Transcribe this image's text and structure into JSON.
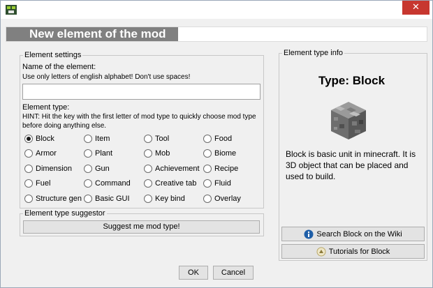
{
  "window": {
    "title": "",
    "close_glyph": "✕",
    "icon": "mcreator-app-icon"
  },
  "heading": "New element of the mod",
  "element_settings": {
    "legend": "Element settings",
    "name_label": "Name of the element:",
    "name_hint": "Use only letters of english alphabet! Don't use spaces!",
    "name_value": "",
    "type_label": "Element type:",
    "type_hint_line1": "HINT: Hit the key with the first letter of mod type to quickly choose mod type",
    "type_hint_line2": "before doing anything else.",
    "types": [
      {
        "label": "Block",
        "checked": true
      },
      {
        "label": "Item",
        "checked": false
      },
      {
        "label": "Tool",
        "checked": false
      },
      {
        "label": "Food",
        "checked": false
      },
      {
        "label": "Armor",
        "checked": false
      },
      {
        "label": "Plant",
        "checked": false
      },
      {
        "label": "Mob",
        "checked": false
      },
      {
        "label": "Biome",
        "checked": false
      },
      {
        "label": "Dimension",
        "checked": false
      },
      {
        "label": "Gun",
        "checked": false
      },
      {
        "label": "Achievement",
        "checked": false
      },
      {
        "label": "Recipe",
        "checked": false
      },
      {
        "label": "Fuel",
        "checked": false
      },
      {
        "label": "Command",
        "checked": false
      },
      {
        "label": "Creative tab",
        "checked": false
      },
      {
        "label": "Fluid",
        "checked": false
      },
      {
        "label": "Structure gen",
        "checked": false
      },
      {
        "label": "Basic GUI",
        "checked": false
      },
      {
        "label": "Key bind",
        "checked": false
      },
      {
        "label": "Overlay",
        "checked": false
      }
    ]
  },
  "suggestor": {
    "legend": "Element type suggestor",
    "button_label": "Suggest me mod type!"
  },
  "type_info": {
    "legend": "Element type info",
    "title": "Type: Block",
    "image": "minecraft-cobblestone-block",
    "description": "Block is basic unit in minecraft. It is 3D object that can be placed and used to build.",
    "wiki_button": "Search Block on the Wiki",
    "tutorials_button": "Tutorials for Block"
  },
  "footer": {
    "ok_label": "OK",
    "cancel_label": "Cancel"
  }
}
